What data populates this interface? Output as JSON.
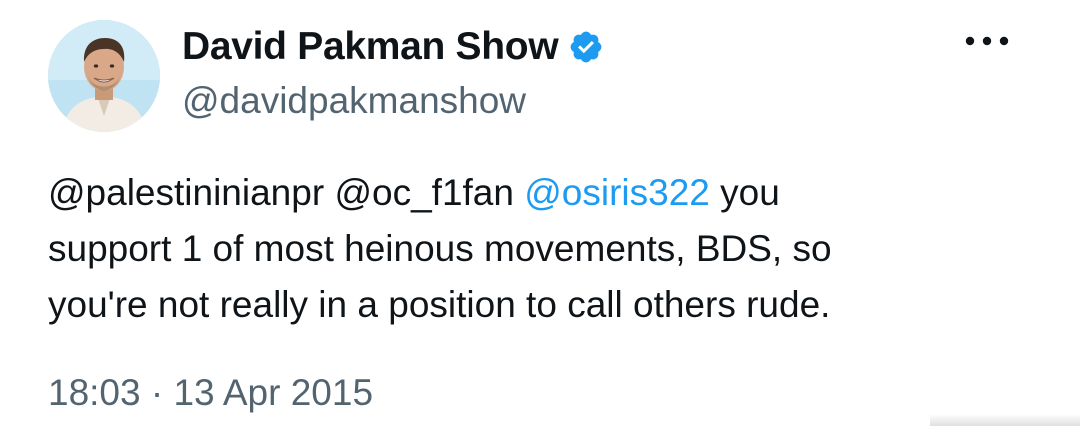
{
  "author": {
    "name": "David Pakman Show",
    "handle": "@davidpakmanshow",
    "verified_icon": "verified-badge-icon",
    "avatar": "profile-photo"
  },
  "more_menu": {
    "icon": "more-horizontal-icon"
  },
  "tweet": {
    "mentions": [
      "@palestininianpr",
      "@oc_f1fan",
      "@osiris322"
    ],
    "line1_rest": "you",
    "line2": "support 1 of most heinous movements, BDS, so",
    "line3": "you're not really in a position to call others rude.",
    "timestamp": "18:03 · 13 Apr 2015"
  },
  "colors": {
    "text": "#0f1419",
    "secondary": "#536471",
    "link": "#1d9bf0",
    "verified": "#1d9bf0"
  }
}
